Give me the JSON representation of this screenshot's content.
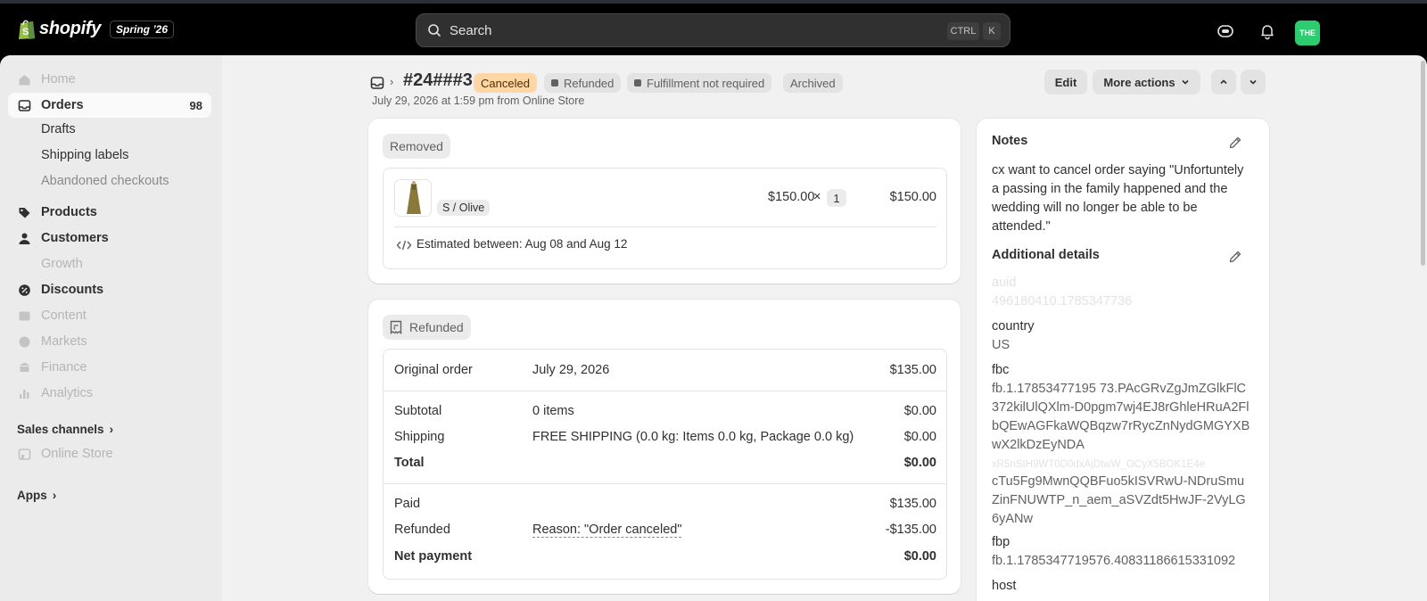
{
  "topbar": {
    "logo_text": "shopify",
    "season_badge": "Spring ’26",
    "search_placeholder": "Search",
    "shortcut_ctrl": "CTRL",
    "shortcut_key": "K",
    "avatar_initials": "THE"
  },
  "sidebar": {
    "home": "Home",
    "orders": "Orders",
    "orders_count": "98",
    "drafts": "Drafts",
    "shipping_labels": "Shipping labels",
    "abandoned_checkouts": "Abandoned checkouts",
    "products": "Products",
    "customers": "Customers",
    "growth": "Growth",
    "discounts": "Discounts",
    "content": "Content",
    "markets": "Markets",
    "finance": "Finance",
    "analytics": "Analytics",
    "sales_channels": "Sales channels",
    "online_store": "Online Store",
    "apps": "Apps"
  },
  "header": {
    "order_id": "#24###3",
    "tags": {
      "canceled": "Canceled",
      "refunded": "Refunded",
      "fulfillment": "Fulfillment not required",
      "archived": "Archived"
    },
    "meta": "July 29, 2026 at 1:59 pm from Online Store",
    "edit": "Edit",
    "more_actions": "More actions"
  },
  "removed_card": {
    "label": "Removed",
    "variant": "S / Olive",
    "unit_price": "$150.00",
    "times": "×",
    "quantity": "1",
    "line_total": "$150.00",
    "estimate": "Estimated between: Aug 08 and Aug 12"
  },
  "refunded_card": {
    "label": "Refunded",
    "original_order_label": "Original order",
    "original_order_date": "July 29, 2026",
    "original_order_amount": "$135.00",
    "subtotal_label": "Subtotal",
    "subtotal_items": "0 items",
    "subtotal_amount": "$0.00",
    "shipping_label": "Shipping",
    "shipping_desc": "FREE SHIPPING (0.0 kg: Items 0.0 kg, Package 0.0 kg)",
    "shipping_amount": "$0.00",
    "total_label": "Total",
    "total_amount": "$0.00",
    "paid_label": "Paid",
    "paid_amount": "$135.00",
    "refunded_label": "Refunded",
    "refund_reason": "Reason: \"Order canceled\"",
    "refunded_amount": "-$135.00",
    "net_label": "Net payment",
    "net_amount": "$0.00"
  },
  "notes_card": {
    "notes_title": "Notes",
    "notes_text": "cx want to cancel order saying \"Unfortuntely a passing in the family happened and the wedding will no longer be able to be attended.\"",
    "additional_title": "Additional details",
    "auid_key": "auid",
    "auid_val": "496180410.1785347736",
    "country_key": "country",
    "country_val": "US",
    "fbc_key": "fbc",
    "fbc_val_a": "fb.1.17853477195 73.PAcGRvZgJmZGlkFlC372kilUlQXlm-D0pgm7wj4EJ8rGhleHRuA2FlbQEwAGFkaWQBqzw7rRycZnNydGMGYXBwX2lkDzEyNDA",
    "fbc_val_faded": "xR5nStH9WT0D0dxAjDtwW_OCyX5BOK1E4e",
    "fbc_val_b": "cTu5Fg9MwnQQBFuo5kISVRwU-NDruSmuZinFNUWTP_n_aem_aSVZdt5HwJF-2VyLG6yANw",
    "fbp_key": "fbp",
    "fbp_val": "fb.1.1785347719576.40831186615331092",
    "host_key": "host"
  },
  "colors": {
    "canceled_tag_bg": "#ffd6a4",
    "avatar_bg": "#2ecc71"
  }
}
